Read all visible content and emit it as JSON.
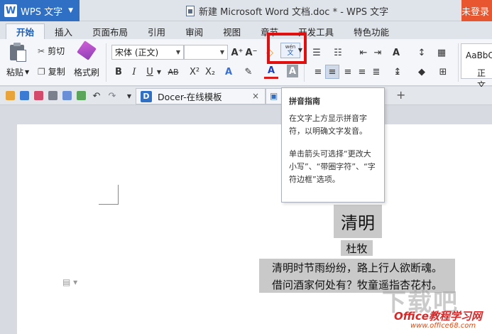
{
  "app": {
    "name": "WPS 文字",
    "logo": "W"
  },
  "window": {
    "title": "新建 Microsoft Word 文档.doc * - WPS 文字",
    "login": "未登录"
  },
  "tabs": [
    "开始",
    "插入",
    "页面布局",
    "引用",
    "审阅",
    "视图",
    "章节",
    "开发工具",
    "特色功能"
  ],
  "ribbon": {
    "paste": "粘贴",
    "cut": "剪切",
    "copy": "复制",
    "format_painter": "格式刷",
    "font_name": "宋体 (正文)",
    "font_size": "",
    "bold": "B",
    "italic": "I",
    "underline": "U",
    "strikethrough": "AB",
    "superscript": "X²",
    "subscript": "X₂",
    "grow_font": "A⁺",
    "shrink_font": "A⁻",
    "pinyin_top": "wén",
    "pinyin_bottom": "文",
    "style_preview": "AaBbC",
    "style_name": "正文"
  },
  "quickbar": {
    "tab_label": "Docer-在线模板",
    "tab_logo": "D",
    "close": "×",
    "new_tab": "+"
  },
  "tooltip": {
    "title": "拼音指南",
    "line1": "在文字上方显示拼音字符，以明确文字发音。",
    "line2": "单击箭头可选择“更改大小写”、“带圈字符”、“字符边框”选项。"
  },
  "document": {
    "title": "清明",
    "author": "杜牧",
    "line1": "清明时节雨纷纷，路上行人欲断魂。",
    "line2": "借问酒家何处有？牧童遥指杏花村。"
  },
  "watermark": {
    "main": "Office教程学习网",
    "url": "www.office68.com",
    "overlay": "下载吧"
  },
  "colors": {
    "accent": "#2f6fc4",
    "login": "#e7562f",
    "highlight": "#e01010"
  }
}
